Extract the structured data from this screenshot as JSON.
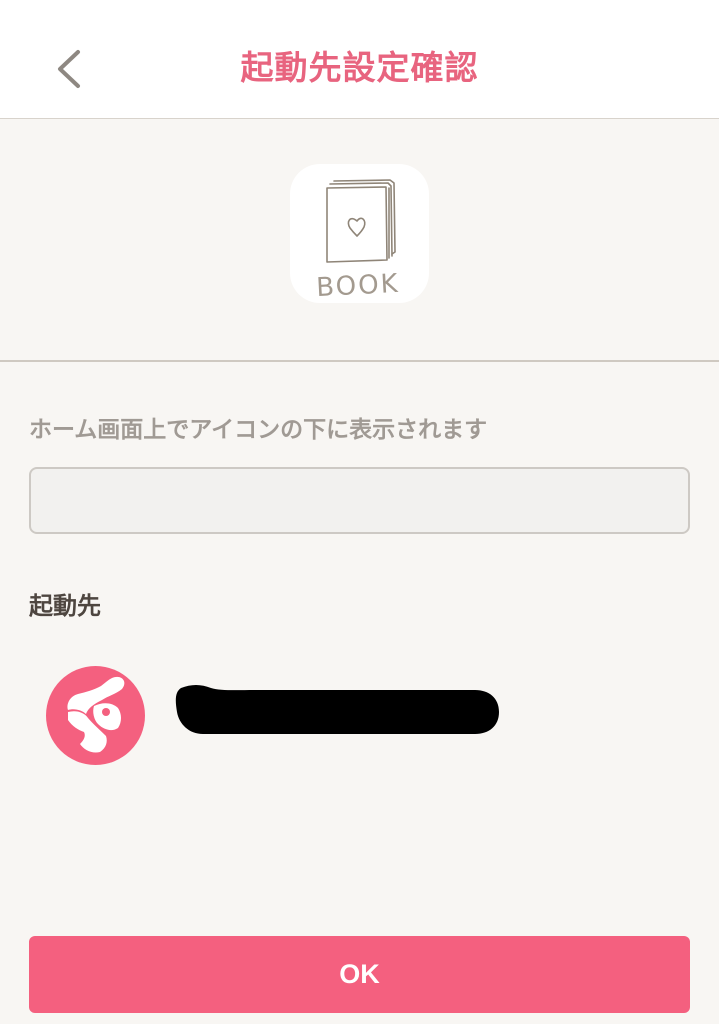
{
  "header": {
    "title": "起動先設定確認",
    "back_icon": "chevron-left-icon"
  },
  "app_icon": {
    "label": "BOOK",
    "icon": "book-heart-icon"
  },
  "name_field": {
    "label": "ホーム画面上でアイコンの下に表示されます",
    "value": "",
    "placeholder": ""
  },
  "launch_target": {
    "section_title": "起動先",
    "icon": "rabbit-globe-icon"
  },
  "footer": {
    "ok_label": "OK"
  },
  "colors": {
    "accent": "#e8647f",
    "button": "#f4607f",
    "background": "#f8f6f3",
    "header_bg": "#ffffff",
    "label_gray": "#a09a94"
  }
}
